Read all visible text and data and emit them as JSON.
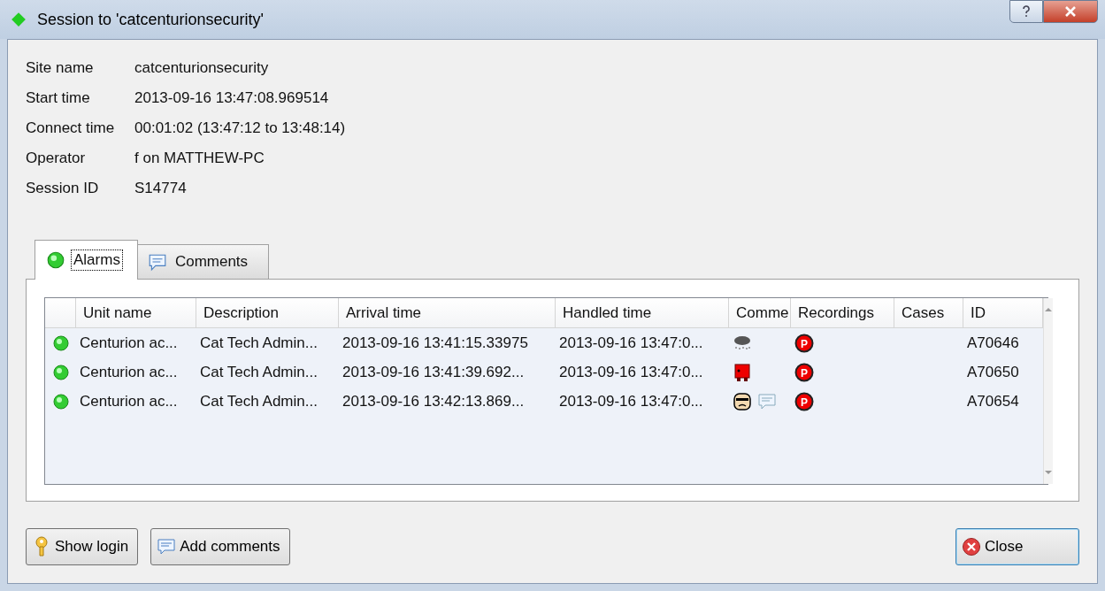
{
  "window": {
    "title": "Session to 'catcenturionsecurity'"
  },
  "info": [
    {
      "label": "Site name",
      "value": "catcenturionsecurity"
    },
    {
      "label": "Start time",
      "value": "2013-09-16 13:47:08.969514"
    },
    {
      "label": "Connect time",
      "value": "00:01:02 (13:47:12 to 13:48:14)"
    },
    {
      "label": "Operator",
      "value": "f on MATTHEW-PC"
    },
    {
      "label": "Session ID",
      "value": "S14774"
    }
  ],
  "tabs": [
    {
      "label": "Alarms",
      "kind": "alarm",
      "selected": true
    },
    {
      "label": "Comments",
      "kind": "comment",
      "selected": false
    }
  ],
  "table": {
    "columns": [
      "Unit name",
      "Description",
      "Arrival time",
      "Handled time",
      "Comme",
      "Recordings",
      "Cases",
      "ID"
    ],
    "rows": [
      {
        "unit": "Centurion ac...",
        "description": "Cat Tech Admin...",
        "arrival": "2013-09-16 13:41:15.33975",
        "handled": "2013-09-16 13:47:0...",
        "icons": [
          {
            "kind": "storm"
          }
        ],
        "recording": "P",
        "id": "A70646"
      },
      {
        "unit": "Centurion ac...",
        "description": "Cat Tech Admin...",
        "arrival": "2013-09-16 13:41:39.692...",
        "handled": "2013-09-16 13:47:0...",
        "icons": [
          {
            "kind": "creature"
          }
        ],
        "recording": "P",
        "id": "A70650"
      },
      {
        "unit": "Centurion ac...",
        "description": "Cat Tech Admin...",
        "arrival": "2013-09-16 13:42:13.869...",
        "handled": "2013-09-16 13:47:0...",
        "icons": [
          {
            "kind": "face"
          },
          {
            "kind": "comment"
          }
        ],
        "recording": "P",
        "id": "A70654"
      }
    ]
  },
  "buttons": [
    {
      "label": "Show login",
      "kind": "key"
    },
    {
      "label": "Add comments",
      "kind": "comment"
    },
    {
      "label": "Close",
      "kind": "close"
    }
  ]
}
